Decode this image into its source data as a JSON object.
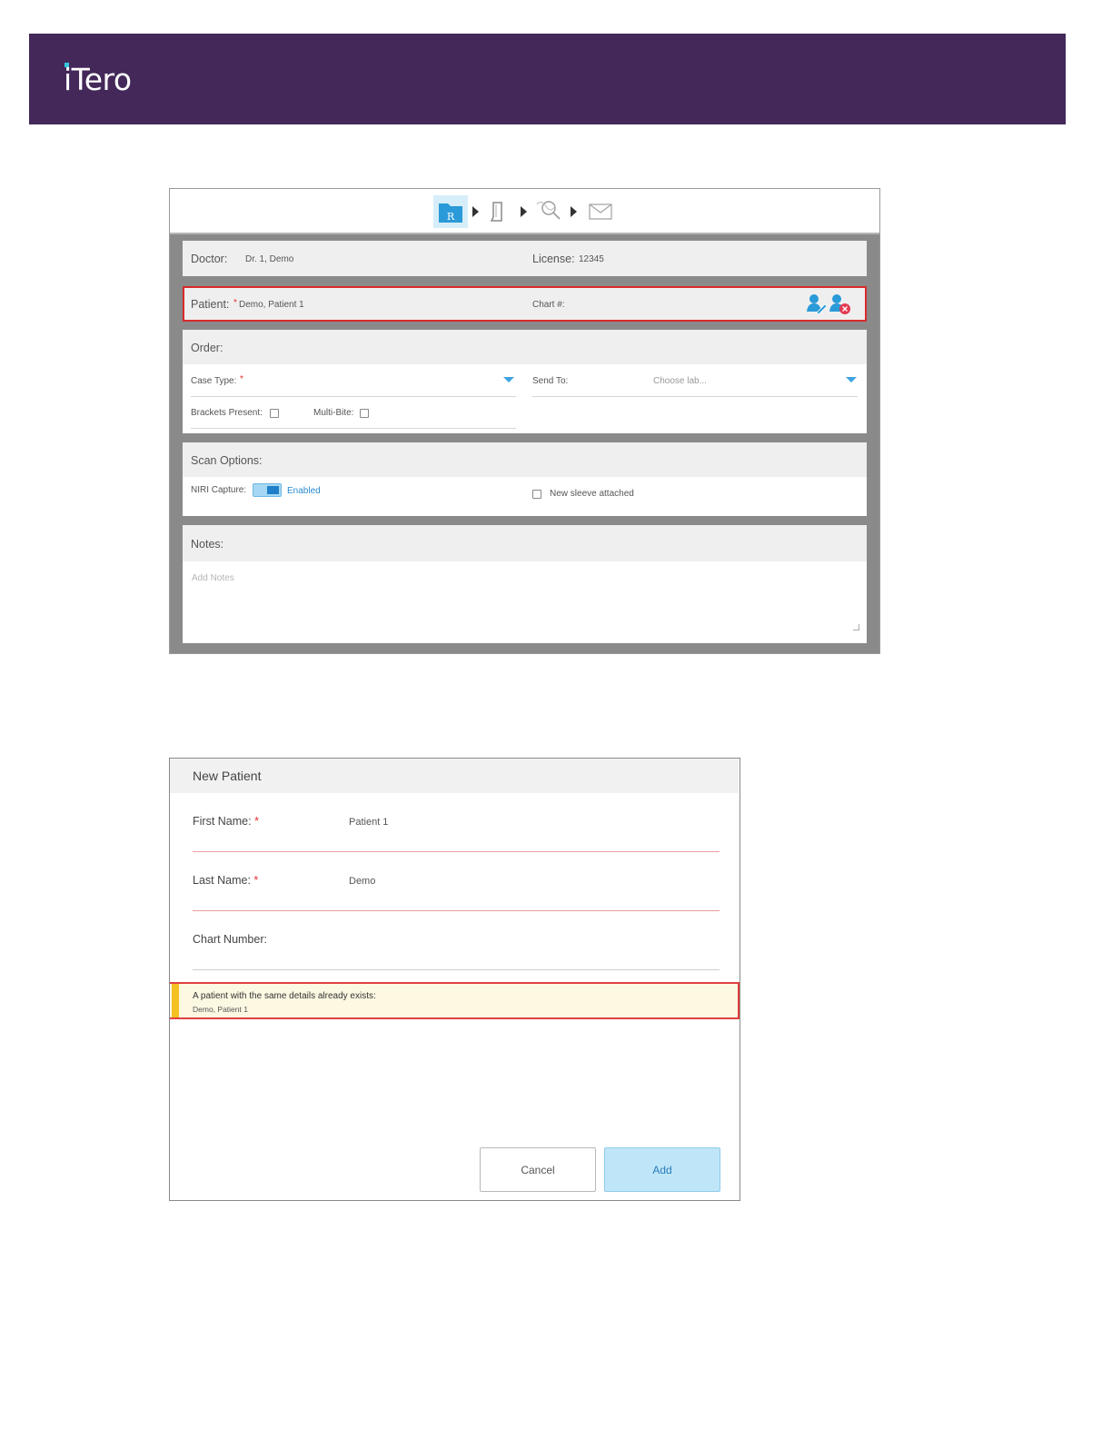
{
  "brand": {
    "logo_text": "iTero"
  },
  "rx_form": {
    "wizard_steps": [
      {
        "icon": "rx-folder-icon",
        "badge": "R",
        "active": true
      },
      {
        "icon": "scan-handpiece-icon",
        "active": false
      },
      {
        "icon": "view-scan-icon",
        "active": false
      },
      {
        "icon": "send-envelope-icon",
        "active": false
      }
    ],
    "doctor": {
      "label": "Doctor:",
      "value": "Dr. 1, Demo"
    },
    "license": {
      "label": "License:",
      "value": "12345"
    },
    "patient": {
      "label": "Patient:",
      "required_mark": "*",
      "value": "Demo, Patient 1"
    },
    "chart": {
      "label": "Chart #:"
    },
    "order": {
      "title": "Order:",
      "case_type_label": "Case Type:",
      "case_type_required": "*",
      "send_to_label": "Send To:",
      "send_to_placeholder": "Choose lab...",
      "brackets_label": "Brackets Present:",
      "multibite_label": "Multi-Bite:"
    },
    "scan_options": {
      "title": "Scan Options:",
      "niri_label": "NIRI Capture:",
      "niri_state": "Enabled",
      "sleeve_label": "New sleeve attached"
    },
    "notes": {
      "title": "Notes:",
      "placeholder": "Add Notes"
    }
  },
  "new_patient": {
    "title": "New Patient",
    "first_name": {
      "label": "First Name:",
      "required_mark": "*",
      "value": "Patient 1"
    },
    "last_name": {
      "label": "Last Name:",
      "required_mark": "*",
      "value": "Demo"
    },
    "chart_number": {
      "label": "Chart Number:",
      "value": ""
    },
    "warning": {
      "message": "A patient with the same details already exists:",
      "patient": "Demo, Patient 1"
    },
    "buttons": {
      "cancel": "Cancel",
      "add": "Add"
    }
  },
  "colors": {
    "banner": "#432859",
    "accent_blue": "#3ea3e0",
    "highlight_red": "#e04040",
    "warning_bar": "#f5c021"
  }
}
